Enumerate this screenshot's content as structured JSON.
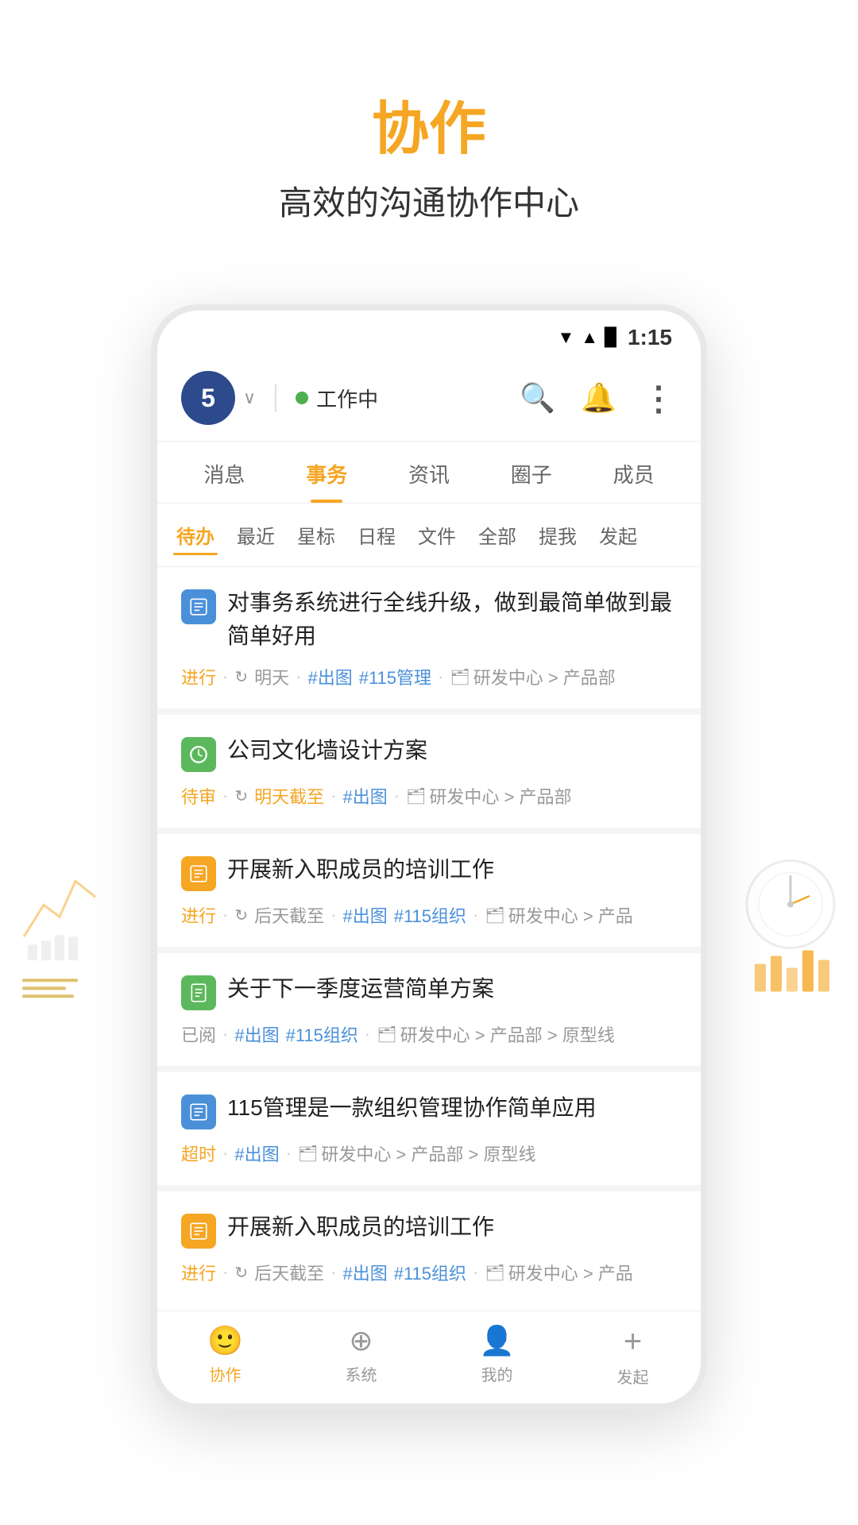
{
  "header": {
    "title": "协作",
    "subtitle": "高效的沟通协作中心"
  },
  "statusBar": {
    "time": "1:15",
    "wifi": "▲",
    "signal": "▲",
    "battery": "▉"
  },
  "appHeader": {
    "avatarNumber": "5",
    "dropdownArrow": "∨",
    "statusLabel": "工作中",
    "icons": {
      "search": "🔍",
      "bell": "🔔",
      "more": "⋮"
    }
  },
  "navTabs": [
    {
      "id": "messages",
      "label": "消息",
      "active": false
    },
    {
      "id": "tasks",
      "label": "事务",
      "active": true
    },
    {
      "id": "news",
      "label": "资讯",
      "active": false
    },
    {
      "id": "circles",
      "label": "圈子",
      "active": false
    },
    {
      "id": "members",
      "label": "成员",
      "active": false
    }
  ],
  "filterTabs": [
    {
      "id": "todo",
      "label": "待办",
      "active": true
    },
    {
      "id": "recent",
      "label": "最近",
      "active": false
    },
    {
      "id": "starred",
      "label": "星标",
      "active": false
    },
    {
      "id": "schedule",
      "label": "日程",
      "active": false
    },
    {
      "id": "files",
      "label": "文件",
      "active": false
    },
    {
      "id": "all",
      "label": "全部",
      "active": false
    },
    {
      "id": "mentioned",
      "label": "提我",
      "active": false
    },
    {
      "id": "started",
      "label": "发起",
      "active": false
    }
  ],
  "tasks": [
    {
      "id": 1,
      "icon": "📋",
      "iconColor": "blue",
      "title": "对事务系统进行全线升级，做到最简单做到最简单好用",
      "status": "进行",
      "statusColor": "orange",
      "date": "明天",
      "dateColor": "normal",
      "tags": [
        "#出图",
        "#115管理"
      ],
      "path": "研发中心 > 产品部"
    },
    {
      "id": 2,
      "icon": "🔄",
      "iconColor": "green",
      "title": "公司文化墙设计方案",
      "status": "待审",
      "statusColor": "orange",
      "date": "明天截至",
      "dateColor": "orange",
      "tags": [
        "#出图"
      ],
      "path": "研发中心 > 产品部"
    },
    {
      "id": 3,
      "icon": "📋",
      "iconColor": "orange",
      "title": "开展新入职成员的培训工作",
      "status": "进行",
      "statusColor": "orange",
      "date": "后天截至",
      "dateColor": "normal",
      "tags": [
        "#出图",
        "#115组织"
      ],
      "path": "研发中心 > 产品"
    },
    {
      "id": 4,
      "icon": "📄",
      "iconColor": "green",
      "title": "关于下一季度运营简单方案",
      "status": "已阅",
      "statusColor": "gray",
      "date": "",
      "dateColor": "normal",
      "tags": [
        "#出图",
        "#115组织"
      ],
      "path": "研发中心 > 产品部 > 原型线"
    },
    {
      "id": 5,
      "icon": "📋",
      "iconColor": "blue",
      "title": "115管理是一款组织管理协作简单应用",
      "status": "超时",
      "statusColor": "orange",
      "date": "",
      "dateColor": "normal",
      "tags": [
        "#出图"
      ],
      "path": "研发中心 > 产品部 > 原型线"
    },
    {
      "id": 6,
      "icon": "📋",
      "iconColor": "orange",
      "title": "开展新入职成员的培训工作",
      "status": "进行",
      "statusColor": "orange",
      "date": "后天截至",
      "dateColor": "normal",
      "tags": [
        "#出图",
        "#115组织"
      ],
      "path": "研发中心 > 产品"
    }
  ],
  "bottomNav": [
    {
      "id": "collab",
      "label": "协作",
      "active": true,
      "icon": "😊"
    },
    {
      "id": "system",
      "label": "系统",
      "active": false,
      "icon": "⊕"
    },
    {
      "id": "mine",
      "label": "我的",
      "active": false,
      "icon": "👤"
    },
    {
      "id": "start",
      "label": "发起",
      "active": false,
      "icon": "+"
    }
  ]
}
